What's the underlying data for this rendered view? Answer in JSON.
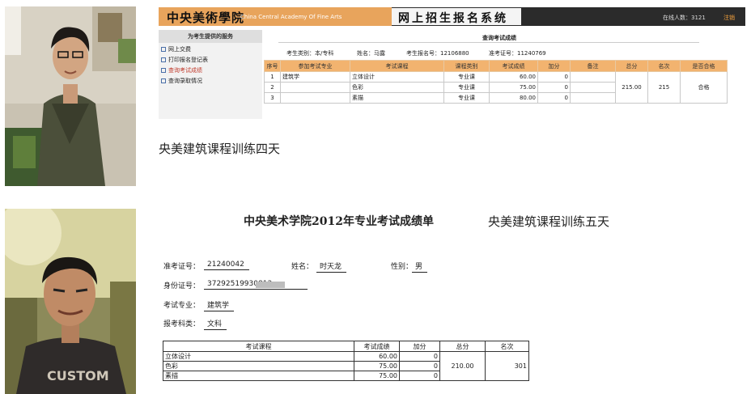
{
  "shot1": {
    "logo_cn": "中央美術學院",
    "logo_en": "China Central Academy Of Fine Arts",
    "system_title": "网上招生报名系统",
    "online_count": "在线人数：3121",
    "logout": "注销",
    "nav": {
      "header": "为考生提供的服务",
      "items": [
        "网上交费",
        "打印报名登记表",
        "查询考试成绩",
        "查询录取情况"
      ]
    },
    "query_title": "查询考试成绩",
    "info": {
      "category": "考生类别：本/专科",
      "name": "姓名：马露",
      "reg_no": "考生报名号：12106880",
      "admit_no": "准考证号：11240769"
    },
    "table": {
      "headers": [
        "序号",
        "参加考试专业",
        "考试课程",
        "课程类别",
        "考试成绩",
        "加分",
        "备注",
        "总分",
        "名次",
        "是否合格"
      ],
      "rows": [
        {
          "no": "1",
          "major": "建筑学",
          "course": "立体设计",
          "type": "专业课",
          "score": "60.00",
          "bonus": "0",
          "note": ""
        },
        {
          "no": "2",
          "major": "",
          "course": "色彩",
          "type": "专业课",
          "score": "75.00",
          "bonus": "0",
          "note": ""
        },
        {
          "no": "3",
          "major": "",
          "course": "素描",
          "type": "专业课",
          "score": "80.00",
          "bonus": "0",
          "note": ""
        }
      ],
      "total": "215.00",
      "rank": "215",
      "pass": "合格"
    }
  },
  "caption_four": "央美建筑课程训练四天",
  "shot2": {
    "title": "中央美术学院2012年专业考试成绩单",
    "admit_label": "准考证号：",
    "admit_value": "21240042",
    "name_label": "姓名：",
    "name_value": "时天龙",
    "gender_label": "性别：",
    "gender_value": "男",
    "id_label": "身份证号：",
    "id_value": "37292519930813",
    "major_label": "考试专业：",
    "major_value": "建筑学",
    "subject_label": "报考科类：",
    "subject_value": "文科",
    "table": {
      "headers": [
        "考试课程",
        "考试成绩",
        "加分",
        "总分",
        "名次"
      ],
      "rows": [
        {
          "course": "立体设计",
          "score": "60.00",
          "bonus": "0"
        },
        {
          "course": "色彩",
          "score": "75.00",
          "bonus": "0"
        },
        {
          "course": "素描",
          "score": "75.00",
          "bonus": "0"
        }
      ],
      "total": "210.00",
      "rank": "301"
    }
  },
  "caption_five": "央美建筑课程训练五天",
  "colors": {
    "header_dark": "#2b2b2b",
    "accent_orange": "#f2b36f",
    "logo_orange": "#e8a45c"
  }
}
